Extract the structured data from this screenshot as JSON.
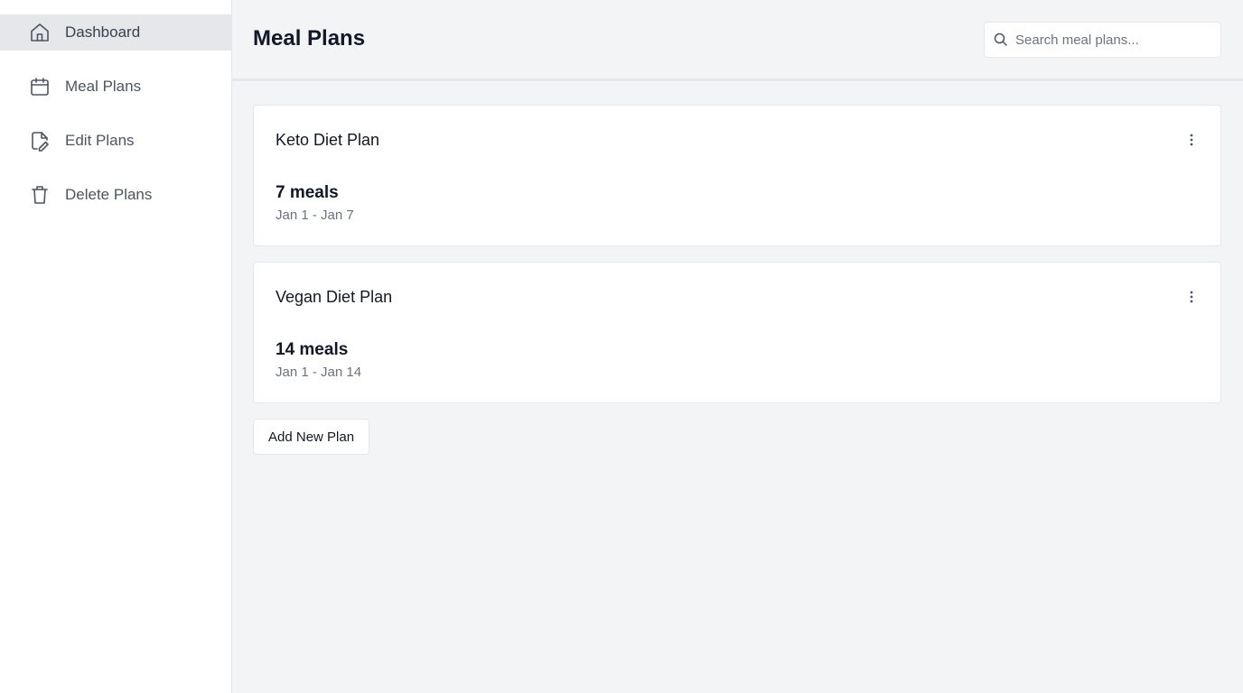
{
  "sidebar": {
    "items": [
      {
        "label": "Dashboard",
        "icon": "home-icon",
        "active": true
      },
      {
        "label": "Meal Plans",
        "icon": "calendar-icon"
      },
      {
        "label": "Edit Plans",
        "icon": "edit-file-icon"
      },
      {
        "label": "Delete Plans",
        "icon": "trash-icon"
      }
    ]
  },
  "header": {
    "title": "Meal Plans",
    "search_placeholder": "Search meal plans..."
  },
  "plans": [
    {
      "name": "Keto Diet Plan",
      "count": "7 meals",
      "dates": "Jan 1 - Jan 7"
    },
    {
      "name": "Vegan Diet Plan",
      "count": "14 meals",
      "dates": "Jan 1 - Jan 14"
    }
  ],
  "actions": {
    "add_label": "Add New Plan"
  },
  "colors": {
    "background": "#f3f4f6",
    "sidebar_active": "#e5e7eb",
    "card": "#ffffff",
    "muted_text": "#6b7280"
  }
}
